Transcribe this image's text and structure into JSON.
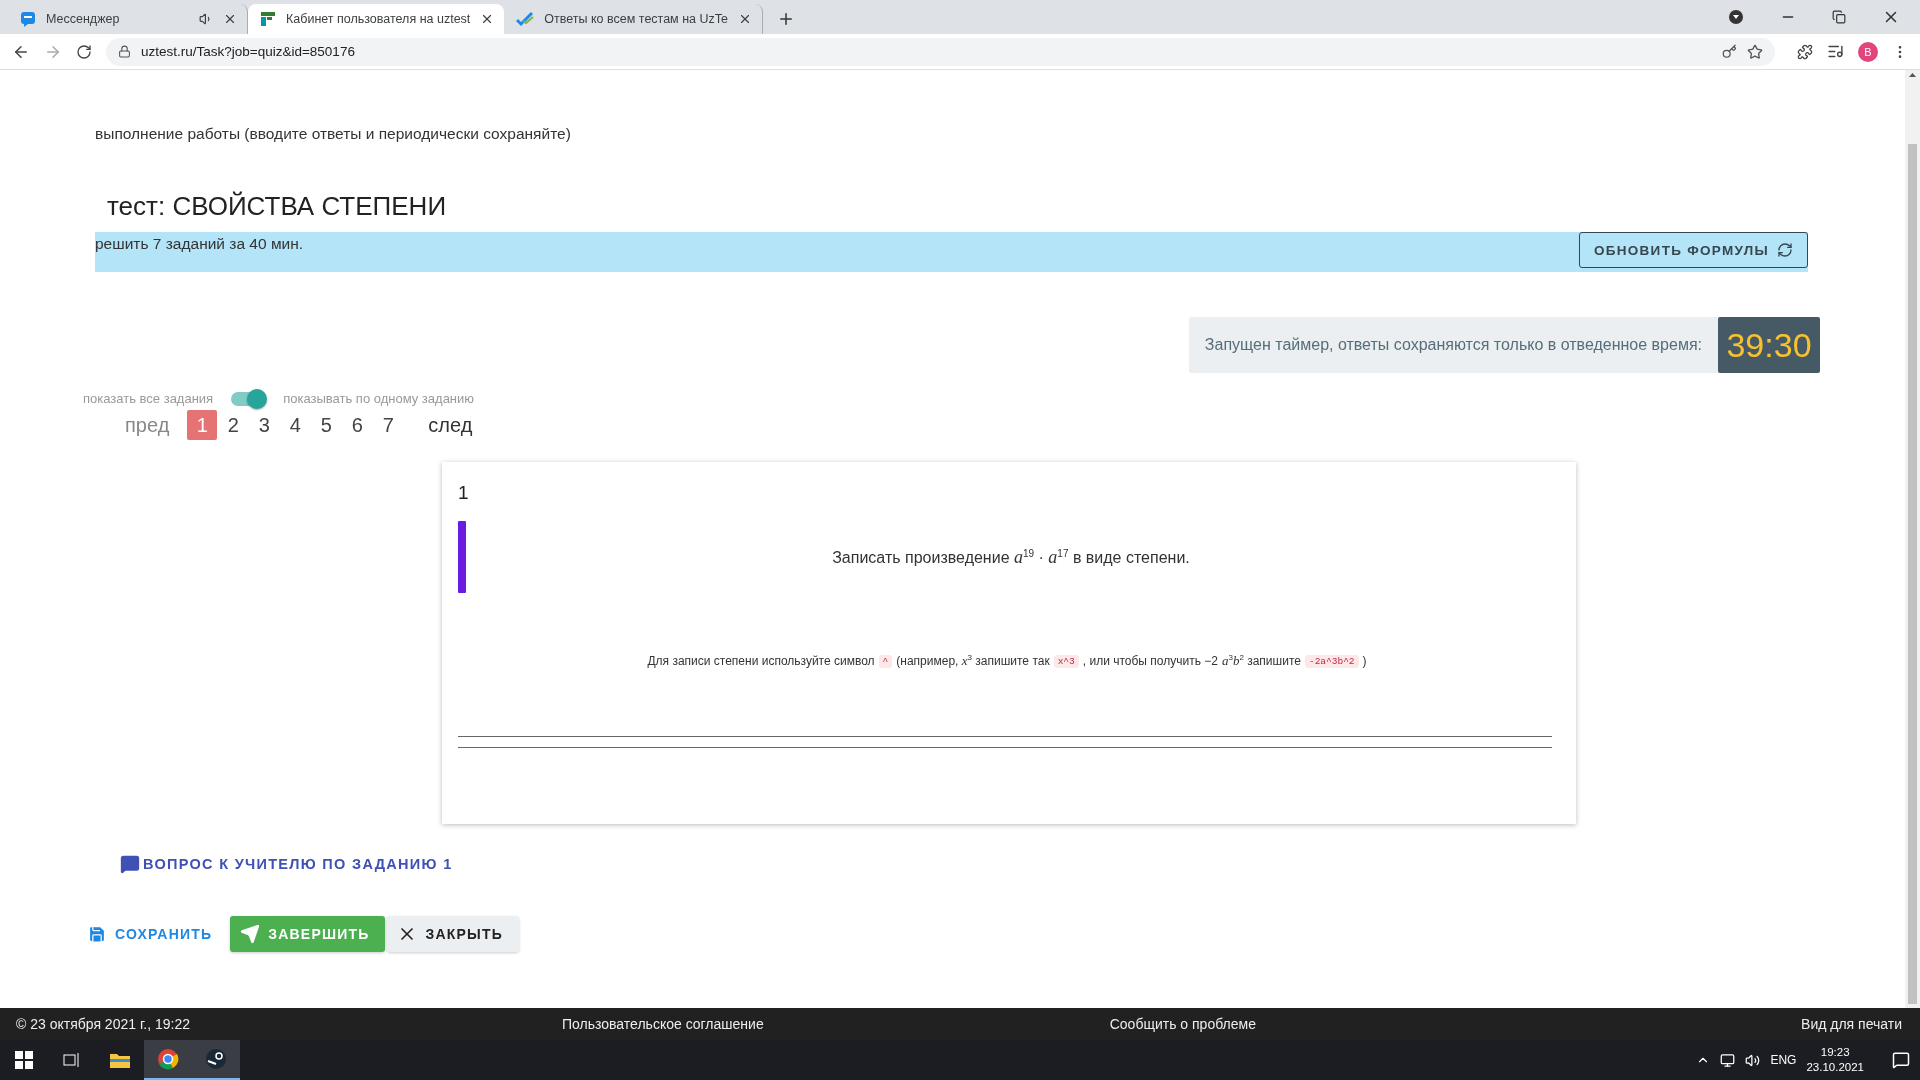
{
  "browser": {
    "tabs": [
      {
        "title": "Мессенджер",
        "selected": false,
        "kind": "messenger",
        "audio": true
      },
      {
        "title": "Кабинет пользователя на uztest",
        "selected": true,
        "kind": "uztest",
        "audio": false
      },
      {
        "title": "Ответы ко всем тестам на UzTe",
        "selected": false,
        "kind": "answers",
        "audio": false
      }
    ],
    "url": "uztest.ru/Task?job=quiz&id=850176",
    "avatar": "В"
  },
  "page": {
    "subtitle": "выполнение работы (вводите ответы и периодически сохраняйте)",
    "title": "тест: СВОЙСТВА СТЕПЕНИ",
    "summary": "решить 7 заданий за 40 мин.",
    "refresh_button": "ОБНОВИТЬ ФОРМУЛЫ",
    "timer_label": "Запущен таймер, ответы сохраняются только в отведенное время:",
    "timer": "39:30",
    "toggle": {
      "left_label": "показать все задания",
      "right_label": "показывать по одному заданию",
      "on": true
    },
    "pagination": {
      "prev": "пред",
      "next": "след",
      "pages": [
        {
          "label": "1",
          "selected": true
        },
        {
          "label": "2",
          "selected": false
        },
        {
          "label": "3",
          "selected": false
        },
        {
          "label": "4",
          "selected": false
        },
        {
          "label": "5",
          "selected": false
        },
        {
          "label": "6",
          "selected": false
        },
        {
          "label": "7",
          "selected": false
        }
      ]
    },
    "question": {
      "number": "1",
      "text": "Записать произведение *a*$^{19}$ · *a*$^{17}$ в виде степени.",
      "hint": [
        {
          "kind": "text",
          "text": "Для записи степени используйте символ"
        },
        {
          "kind": "code",
          "text": "^"
        },
        {
          "kind": "text",
          "text": "(например, *x*$^{3}$ запишите так"
        },
        {
          "kind": "code",
          "text": "x^3"
        },
        {
          "kind": "text",
          "text": ", или чтобы получить −2"
        },
        {
          "kind": "text",
          "text": "*a*$^{3}$*b*$^{2}$ запишите"
        },
        {
          "kind": "code",
          "text": "-2a^3b^2"
        },
        {
          "kind": "text",
          "text": ")"
        }
      ]
    },
    "ask_teacher": "ВОПРОС К УЧИТЕЛЮ ПО ЗАДАНИЮ 1",
    "actions": [
      {
        "kind": "save",
        "label": "СОХРАНИТЬ"
      },
      {
        "kind": "finish",
        "label": "ЗАВЕРШИТЬ"
      },
      {
        "kind": "close",
        "label": "ЗАКРЫТЬ"
      }
    ]
  },
  "footer": {
    "copyright": "© 23 октября 2021 г., 19:22",
    "agreement": "Пользовательское соглашение",
    "report": "Сообщить о проблеме",
    "print": "Вид для печати"
  },
  "taskbar": {
    "language": "ENG",
    "time": "19:23",
    "date": "23.10.2021"
  }
}
